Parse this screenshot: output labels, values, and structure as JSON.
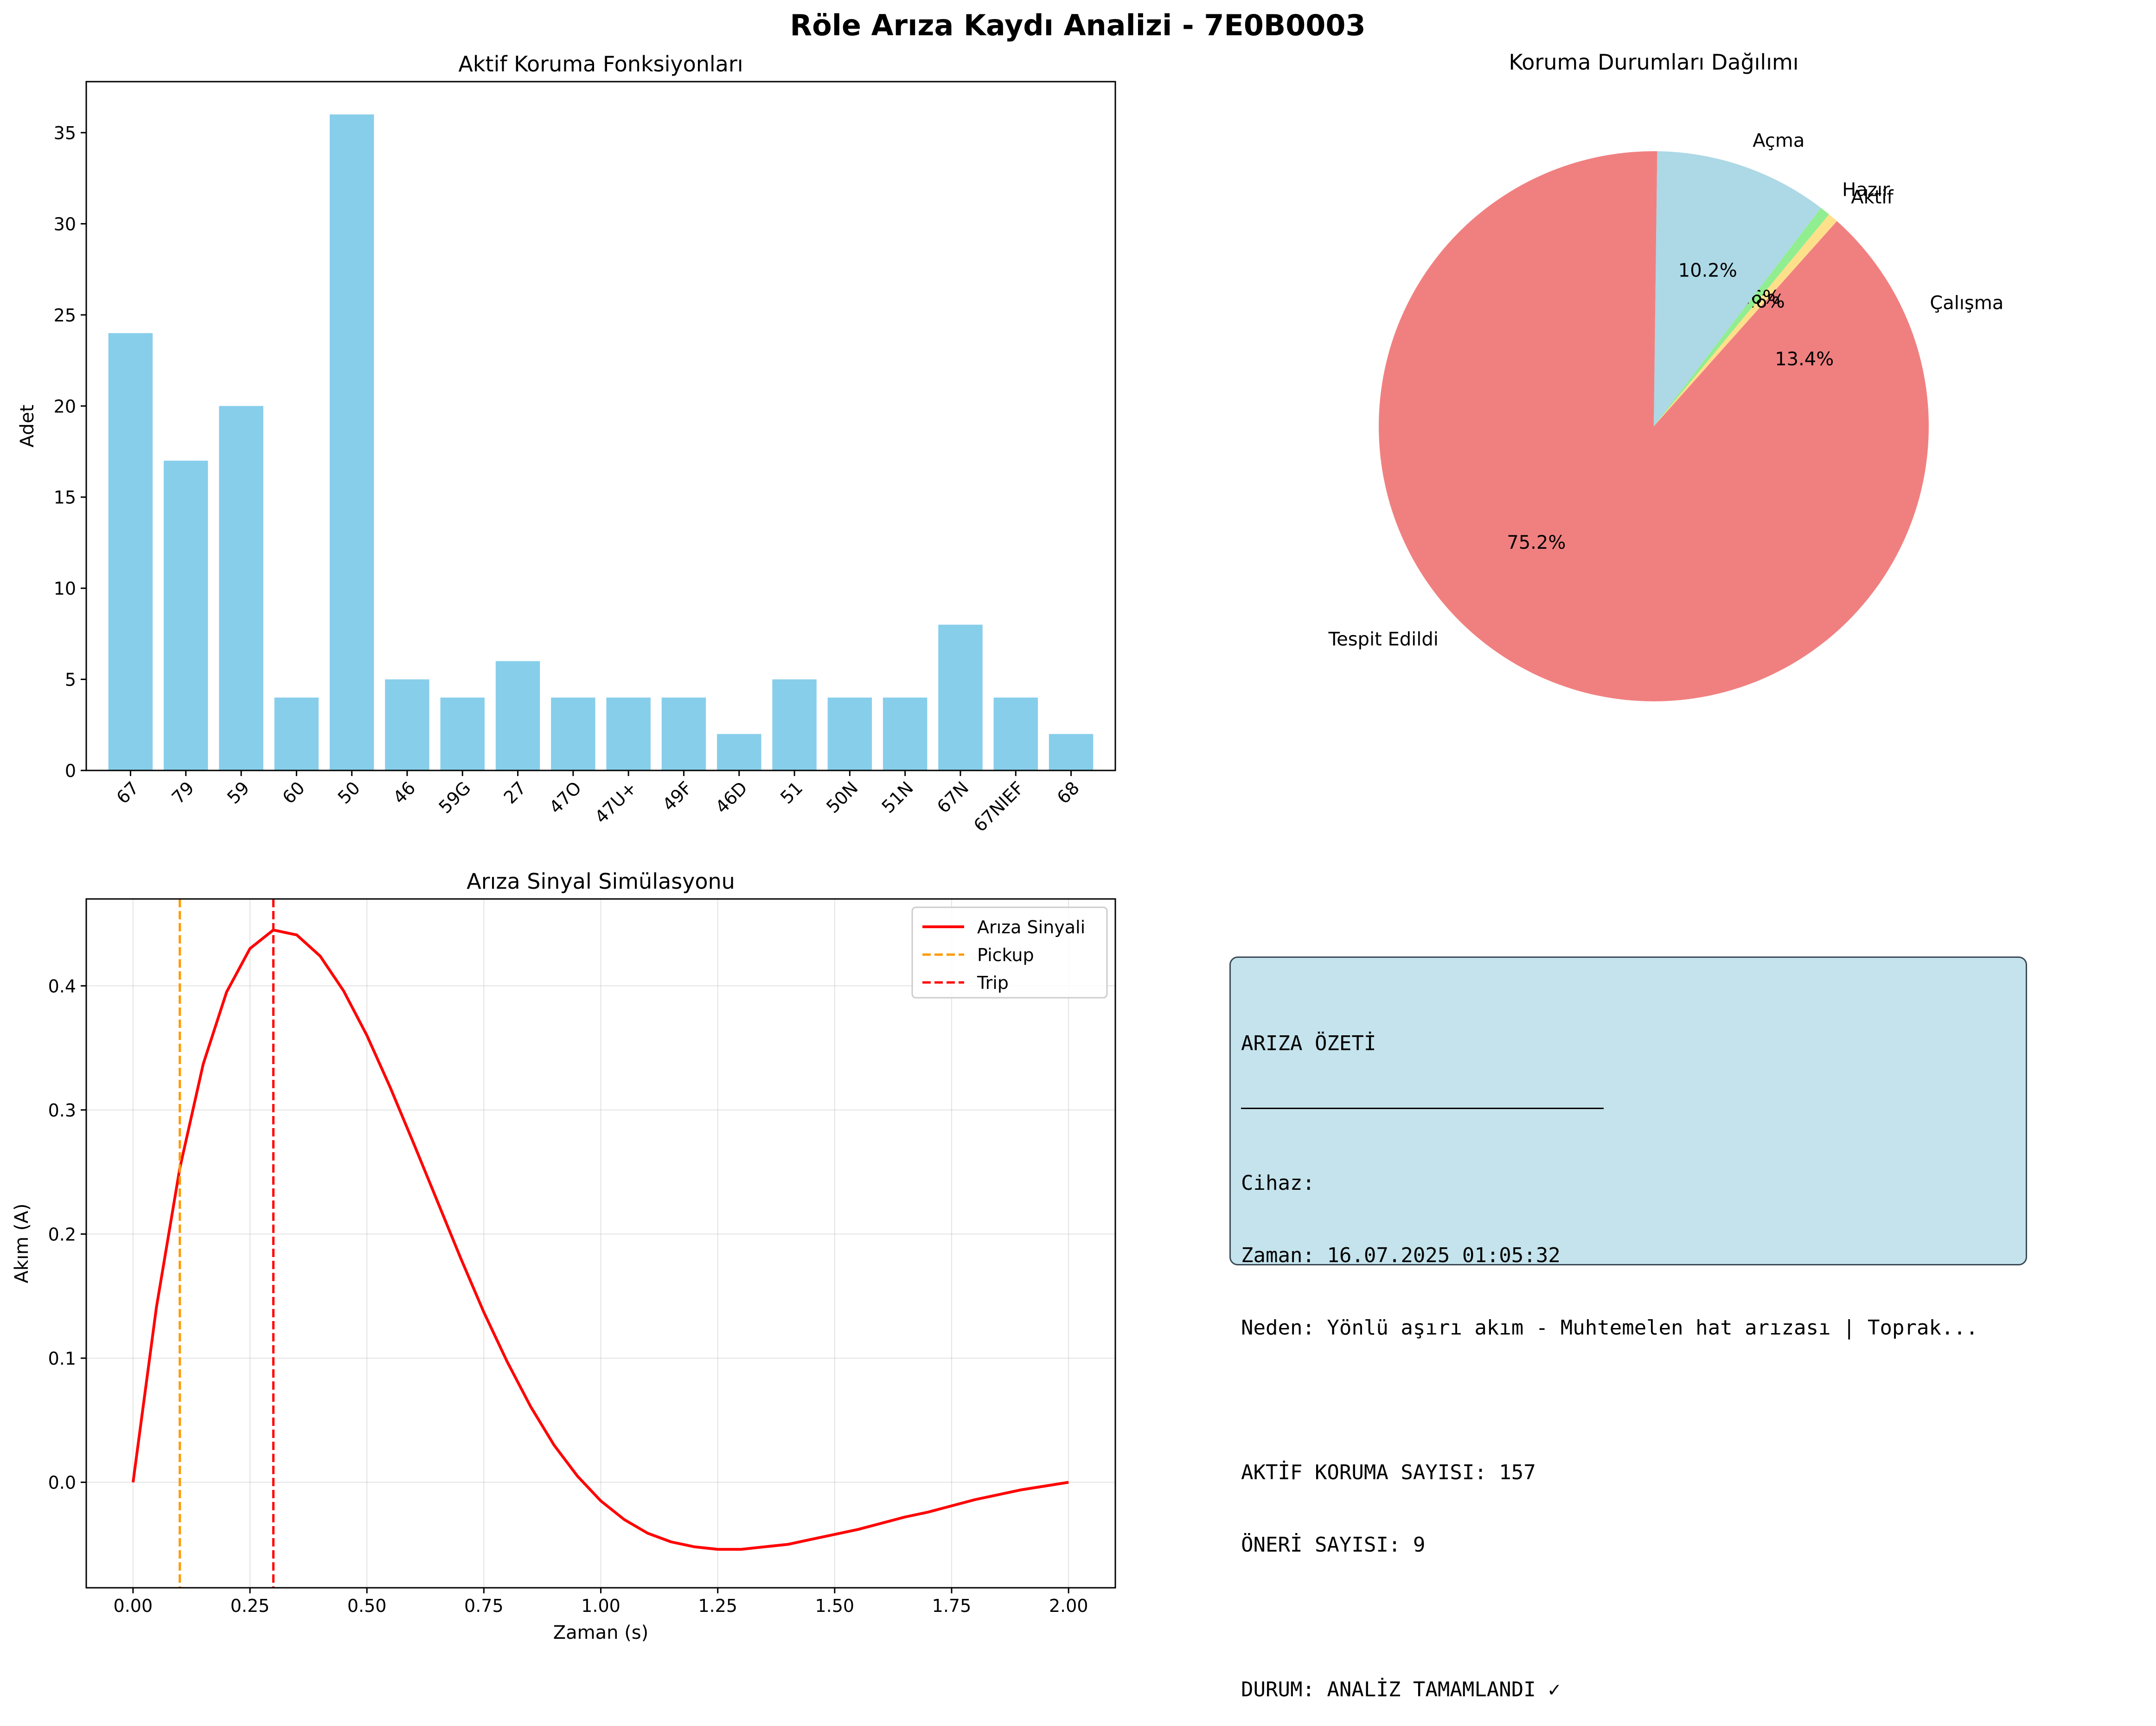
{
  "figure": {
    "suptitle": "Röle Arıza Kaydı Analizi - 7E0B0003"
  },
  "chart_data": [
    {
      "type": "bar",
      "title": "Aktif Koruma Fonksiyonları",
      "xlabel": "",
      "ylabel": "Adet",
      "categories": [
        "67",
        "79",
        "59",
        "60",
        "50",
        "46",
        "59G",
        "27",
        "47O",
        "47U+",
        "49F",
        "46D",
        "51",
        "50N",
        "51N",
        "67N",
        "67NIEF",
        "68"
      ],
      "values": [
        24,
        17,
        20,
        4,
        36,
        5,
        4,
        6,
        4,
        4,
        4,
        2,
        5,
        4,
        4,
        8,
        4,
        2
      ],
      "ylim": [
        0,
        37.8
      ],
      "yticks": [
        0,
        5,
        10,
        15,
        20,
        25,
        30,
        35
      ],
      "bar_color": "#87ceeb",
      "grid": false
    },
    {
      "type": "pie",
      "title": "Koruma Durumları Dağılımı",
      "slices": [
        {
          "label": "Çalışma",
          "value": 13.4,
          "pct_label": "13.4%",
          "color": "#f08080"
        },
        {
          "label": "Aktif",
          "value": 0.6,
          "pct_label": "0.6%",
          "color": "#ffe08a"
        },
        {
          "label": "Hazır",
          "value": 0.6,
          "pct_label": "0.6%",
          "color": "#90ee90"
        },
        {
          "label": "Açma",
          "value": 10.2,
          "pct_label": "10.2%",
          "color": "#add8e6"
        },
        {
          "label": "Tespit Edildi",
          "value": 75.2,
          "pct_label": "75.2%",
          "color": "#f08080"
        }
      ],
      "start_angle_deg": 0,
      "direction": "counterclockwise"
    },
    {
      "type": "line",
      "title": "Arıza Sinyal Simülasyonu",
      "xlabel": "Zaman (s)",
      "ylabel": "Akım (A)",
      "xlim": [
        -0.1,
        2.1
      ],
      "ylim": [
        -0.085,
        0.47
      ],
      "xticks": [
        "0.00",
        "0.25",
        "0.50",
        "0.75",
        "1.00",
        "1.25",
        "1.50",
        "1.75",
        "2.00"
      ],
      "yticks": [
        "0.0",
        "0.1",
        "0.2",
        "0.3",
        "0.4"
      ],
      "grid": true,
      "legend": "top-right",
      "series": [
        {
          "name": "Arıza Sinyali",
          "color": "#ff0000",
          "style": "solid",
          "x": [
            0,
            0.05,
            0.1,
            0.15,
            0.2,
            0.25,
            0.3,
            0.35,
            0.4,
            0.45,
            0.5,
            0.55,
            0.6,
            0.65,
            0.7,
            0.75,
            0.8,
            0.85,
            0.9,
            0.95,
            1.0,
            1.05,
            1.1,
            1.15,
            1.2,
            1.25,
            1.3,
            1.35,
            1.4,
            1.45,
            1.5,
            1.55,
            1.6,
            1.65,
            1.7,
            1.75,
            1.8,
            1.85,
            1.9,
            1.95,
            2.0
          ],
          "y": [
            0,
            0.141,
            0.253,
            0.337,
            0.395,
            0.43,
            0.445,
            0.441,
            0.424,
            0.396,
            0.36,
            0.318,
            0.273,
            0.227,
            0.181,
            0.137,
            0.097,
            0.061,
            0.03,
            0.005,
            -0.015,
            -0.03,
            -0.041,
            -0.048,
            -0.052,
            -0.054,
            -0.054,
            -0.052,
            -0.05,
            -0.046,
            -0.042,
            -0.038,
            -0.033,
            -0.028,
            -0.024,
            -0.019,
            -0.014,
            -0.01,
            -0.006,
            -0.003,
            0
          ]
        },
        {
          "name": "Pickup",
          "color": "#ff9900",
          "style": "dashed",
          "vline_x": 0.1
        },
        {
          "name": "Trip",
          "color": "#ff0000",
          "style": "dashed",
          "vline_x": 0.3
        }
      ]
    }
  ],
  "summary": {
    "title": "ARIZA ÖZETİ",
    "device": "Cihaz:",
    "time": "Zaman: 16.07.2025 01:05:32",
    "reason": "Neden: Yönlü aşırı akım - Muhtemelen hat arızası | Toprak...",
    "active_count": "AKTİF KORUMA SAYISI: 157",
    "suggestion_count": "ÖNERİ SAYISI: 9",
    "status": "DURUM: ANALİZ TAMAMLANDI ✓",
    "background": "#c4e3ec"
  }
}
